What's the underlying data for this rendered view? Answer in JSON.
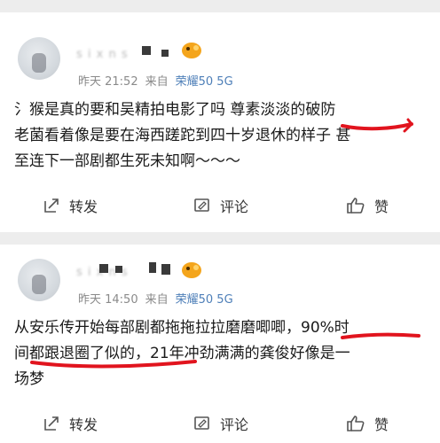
{
  "posts": [
    {
      "time": "昨天 21:52",
      "from": "来自",
      "device": "荣耀50 5G",
      "lines": [
        "氵猴是真的要和吴精拍电影了吗 尊素淡淡的破防",
        "老菌看着像是要在海西蹉跎到四十岁退休的样子 甚",
        "至连下一部剧都生死未知啊～～～"
      ],
      "actions": {
        "repost": "转发",
        "comment": "评论",
        "like": "赞"
      }
    },
    {
      "time": "昨天 14:50",
      "from": "来自",
      "device": "荣耀50 5G",
      "lines": [
        "从安乐传开始每部剧都拖拖拉拉磨磨唧唧，90%时",
        "间都跟退圈了似的，21年冲劲满满的龚俊好像是一",
        "场梦"
      ],
      "actions": {
        "repost": "转发",
        "comment": "评论",
        "like": "赞"
      }
    }
  ],
  "colors": {
    "background": "#ededed",
    "card": "#ffffff",
    "device_link": "#4e7fb8",
    "highlight_mark": "#e1141e"
  },
  "icons": [
    "repost-icon",
    "comment-icon",
    "like-icon"
  ]
}
